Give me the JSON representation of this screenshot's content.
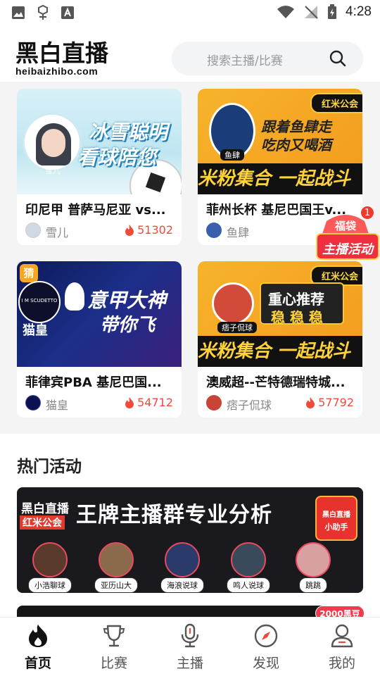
{
  "statusbar": {
    "time": "4:28"
  },
  "header": {
    "logo_cn": "黑白直播",
    "logo_en": "heibaizhibo.com",
    "search_placeholder": "搜索主播/比赛"
  },
  "cards": [
    {
      "title": "印尼甲 普萨马尼亚 vs...",
      "streamer": "雪儿",
      "hot": "51302",
      "thumb_line1": "冰雪聪明",
      "thumb_line2": "看球陪您",
      "avatar_label": "雪儿"
    },
    {
      "title": "菲州长杯 基尼巴国王v...",
      "streamer": "鱼肆",
      "hot": "",
      "thumb_line1": "跟着鱼肆走",
      "thumb_line2": "吃肉又喝酒",
      "tag": "红米公会",
      "strip": "米粉集合 一起战斗",
      "avatar_label": "鱼肆"
    },
    {
      "title": "菲律宾PBA 基尼巴国...",
      "streamer": "猫皇",
      "hot": "54712",
      "thumb_line1": "意甲大神",
      "thumb_line2": "带你飞",
      "corner": "猜",
      "avatar_label": "猫皇",
      "club_text": "I M SCUDETTO"
    },
    {
      "title": "澳威超--芒特德瑞特城...",
      "streamer": "痞子侃球",
      "hot": "57792",
      "thumb_line1": "重心推荐",
      "thumb_line2": "稳 稳 稳",
      "tag": "红米公会",
      "strip": "米粉集合 一起战斗",
      "avatar_label": "痞子侃球"
    }
  ],
  "float_badge": {
    "count": "1",
    "line1": "福袋",
    "line2": "主播活动"
  },
  "hot_section": {
    "title": "热门活动",
    "banner": {
      "logo": "黑白直播",
      "sublogo": "红米公会",
      "headline": "王牌主播群专业分析",
      "helper_line1": "黑白直播",
      "helper_line2": "小助手",
      "streamers": [
        "小浩聊球",
        "亚历山大",
        "海浪说球",
        "鸣人说球",
        "跳跳"
      ]
    },
    "badge2": "2000黑豆"
  },
  "nav": [
    {
      "label": "首页",
      "icon": "home-flame-icon",
      "active": true
    },
    {
      "label": "比赛",
      "icon": "trophy-icon",
      "active": false
    },
    {
      "label": "主播",
      "icon": "microphone-icon",
      "active": false
    },
    {
      "label": "发现",
      "icon": "compass-icon",
      "active": false
    },
    {
      "label": "我的",
      "icon": "user-icon",
      "active": false
    }
  ],
  "colors": {
    "accent": "#f04a3a",
    "brand_dark": "#111111",
    "bg_grey": "#f4f4f5"
  }
}
